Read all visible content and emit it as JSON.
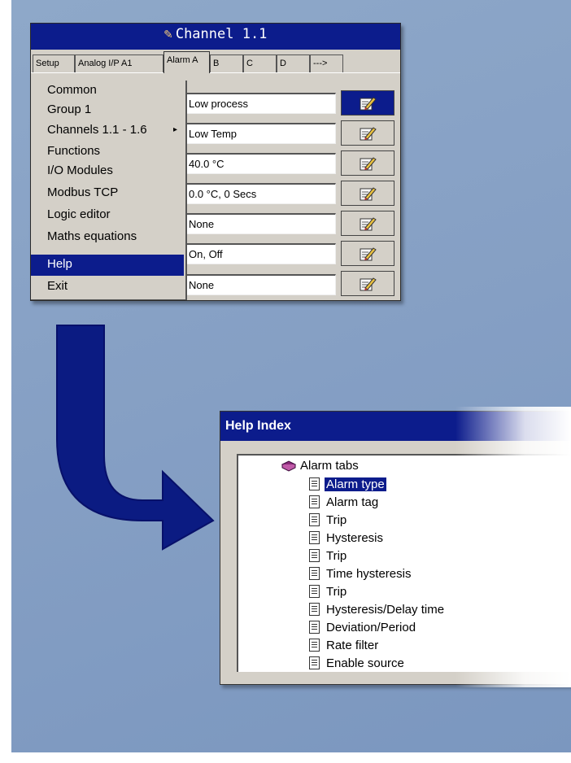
{
  "channel_window": {
    "title": "Channel 1.1",
    "tabs": [
      "Setup",
      "Analog I/P A1",
      "Alarm A",
      "B",
      "C",
      "D",
      "--->"
    ],
    "active_tab": "Alarm A",
    "fields": [
      "Low process",
      "Low Temp",
      "40.0 °C",
      "0.0 °C, 0 Secs",
      "None",
      "On, Off",
      "None"
    ],
    "menu": {
      "items": [
        "Common",
        "Group 1",
        "Channels 1.1 - 1.6",
        "Functions",
        "I/O Modules",
        "Modbus TCP",
        "Logic editor",
        "Maths equations",
        "Help",
        "Exit"
      ],
      "highlighted": "Help",
      "submenu_arrow": "▸"
    }
  },
  "help_window": {
    "title": "Help Index",
    "root": "Alarm tabs",
    "items": [
      "Alarm type",
      "Alarm tag",
      "Trip",
      "Hysteresis",
      "Trip",
      "Time hysteresis",
      "Trip",
      "Hysteresis/Delay time",
      "Deviation/Period",
      "Rate filter",
      "Enable source"
    ],
    "selected": "Alarm type"
  },
  "colors": {
    "titlebar": "#0c1c8c",
    "background": "#859fc4",
    "arrow": "#0b1b82",
    "window": "#d4d0c8"
  },
  "icons": {
    "edit_button": "edit-pencil-icon",
    "help_item": "document-icon",
    "root": "book-icon"
  }
}
